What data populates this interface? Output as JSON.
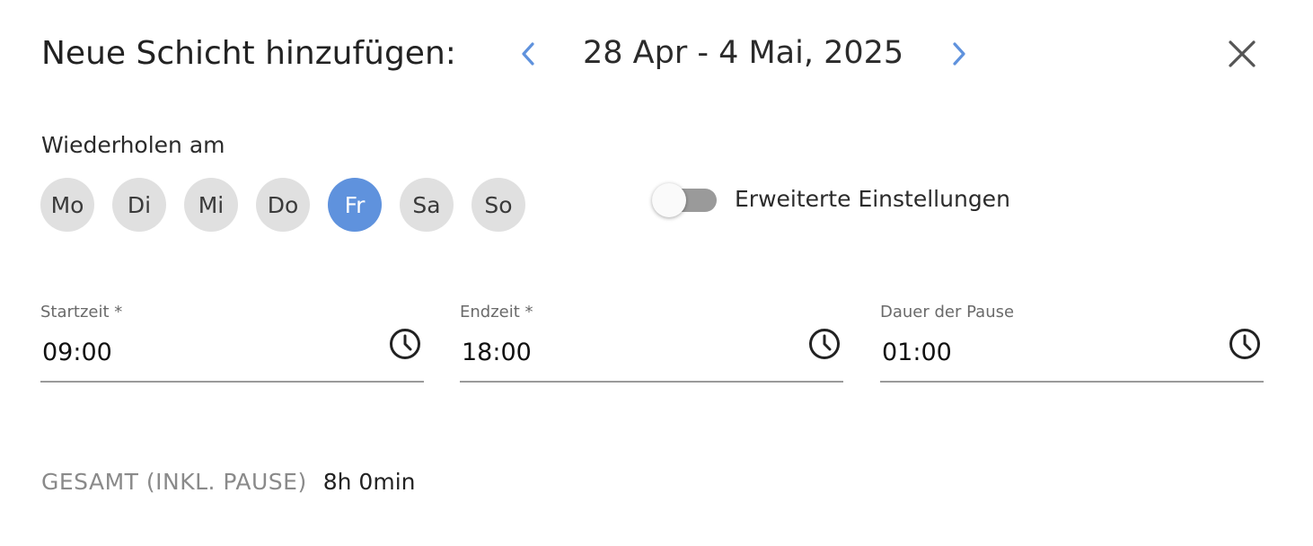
{
  "header": {
    "title": "Neue Schicht hinzufügen:",
    "date_range": "28 Apr - 4 Mai, 2025",
    "prev_icon": "chevron-left-icon",
    "next_icon": "chevron-right-icon",
    "close_icon": "close-icon"
  },
  "repeat": {
    "label": "Wiederholen am",
    "days": [
      {
        "label": "Mo",
        "selected": false
      },
      {
        "label": "Di",
        "selected": false
      },
      {
        "label": "Mi",
        "selected": false
      },
      {
        "label": "Do",
        "selected": false
      },
      {
        "label": "Fr",
        "selected": true
      },
      {
        "label": "Sa",
        "selected": false
      },
      {
        "label": "So",
        "selected": false
      }
    ]
  },
  "advanced": {
    "label": "Erweiterte Einstellungen",
    "enabled": false
  },
  "fields": {
    "start": {
      "label": "Startzeit *",
      "value": "09:00"
    },
    "end": {
      "label": "Endzeit *",
      "value": "18:00"
    },
    "pause": {
      "label": "Dauer der Pause",
      "value": "01:00"
    }
  },
  "total": {
    "label": "GESAMT (INKL. PAUSE)",
    "value": "8h 0min"
  },
  "colors": {
    "accent": "#5f92dd",
    "day_bg": "#e0e0e0",
    "toggle_track": "#9a9a9a"
  }
}
